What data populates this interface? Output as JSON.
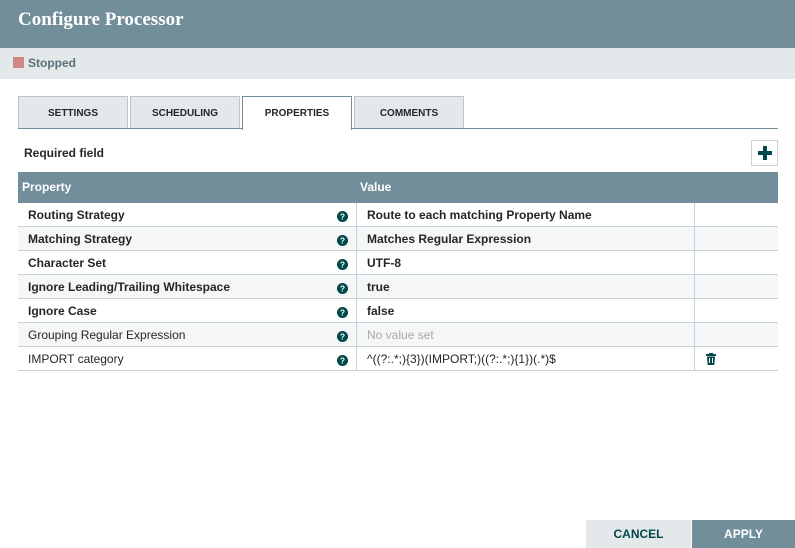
{
  "dialog": {
    "title": "Configure Processor"
  },
  "status": {
    "label": "Stopped",
    "color": "#d18686"
  },
  "tabs": [
    {
      "label": "SETTINGS",
      "active": false
    },
    {
      "label": "SCHEDULING",
      "active": false
    },
    {
      "label": "PROPERTIES",
      "active": true
    },
    {
      "label": "COMMENTS",
      "active": false
    }
  ],
  "properties": {
    "required_label": "Required field",
    "columns": {
      "property": "Property",
      "value": "Value"
    },
    "rows": [
      {
        "name": "Routing Strategy",
        "value": "Route to each matching Property Name",
        "required": true
      },
      {
        "name": "Matching Strategy",
        "value": "Matches Regular Expression",
        "required": true
      },
      {
        "name": "Character Set",
        "value": "UTF-8",
        "required": true
      },
      {
        "name": "Ignore Leading/Trailing Whitespace",
        "value": "true",
        "required": true
      },
      {
        "name": "Ignore Case",
        "value": "false",
        "required": true
      },
      {
        "name": "Grouping Regular Expression",
        "value": "No value set",
        "required": false
      },
      {
        "name": "IMPORT category",
        "value": "^((?:.*;){3})(IMPORT;)((?:.*;){1})(.*)$",
        "required": false
      }
    ]
  },
  "buttons": {
    "cancel": "CANCEL",
    "apply": "APPLY"
  },
  "colors": {
    "header": "#728e9b",
    "accent": "#004849",
    "status_stopped": "#d18686"
  }
}
